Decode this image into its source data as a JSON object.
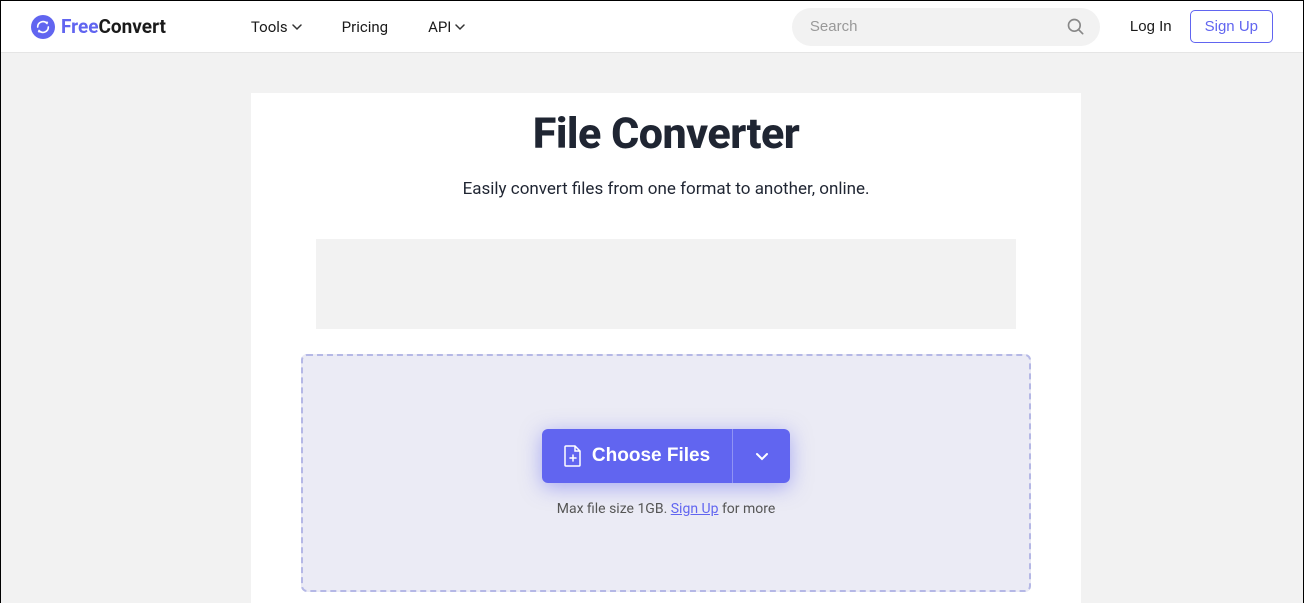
{
  "brand": {
    "name_free": "Free",
    "name_convert": "Convert"
  },
  "nav": {
    "tools": "Tools",
    "pricing": "Pricing",
    "api": "API"
  },
  "search": {
    "placeholder": "Search"
  },
  "auth": {
    "login": "Log In",
    "signup": "Sign Up"
  },
  "main": {
    "title": "File Converter",
    "subtitle": "Easily convert files from one format to another, online.",
    "choose_files": "Choose Files",
    "file_info_prefix": "Max file size 1GB. ",
    "file_info_link": "Sign Up",
    "file_info_suffix": " for more"
  }
}
